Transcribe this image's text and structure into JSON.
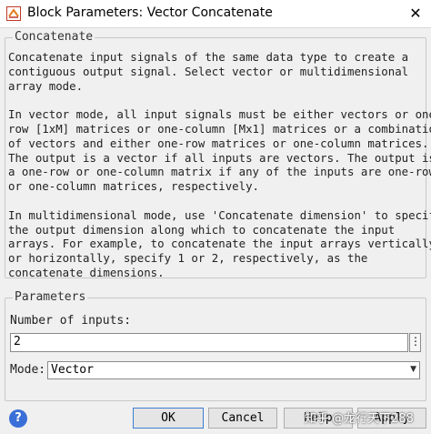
{
  "window": {
    "title": "Block Parameters: Vector Concatenate",
    "close_glyph": "✕"
  },
  "description_group": {
    "legend": "Concatenate",
    "text": "Concatenate input signals of the same data type to create a\ncontiguous output signal. Select vector or multidimensional\narray mode.\n\nIn vector mode, all input signals must be either vectors or one-\nrow [1xM] matrices or one-column [Mx1] matrices or a combination\nof vectors and either one-row matrices or one-column matrices.\nThe output is a vector if all inputs are vectors. The output is\na one-row or one-column matrix if any of the inputs are one-row\nor one-column matrices, respectively.\n\nIn multidimensional mode, use 'Concatenate dimension' to specify\nthe output dimension along which to concatenate the input\narrays. For example, to concatenate the input arrays vertically\nor horizontally, specify 1 or 2, respectively, as the\nconcatenate dimensions."
  },
  "parameters_group": {
    "legend": "Parameters",
    "num_inputs_label": "Number of inputs:",
    "num_inputs_value": "2",
    "dots_glyph": "⋮",
    "mode_label": "Mode:",
    "mode_value": "Vector",
    "mode_arrow": "▼"
  },
  "footer": {
    "help_icon_glyph": "?",
    "ok_label": "OK",
    "cancel_label": "Cancel",
    "help_label": "Help",
    "apply_label": "Apply",
    "watermark": "知乎 @龙行天下288"
  }
}
